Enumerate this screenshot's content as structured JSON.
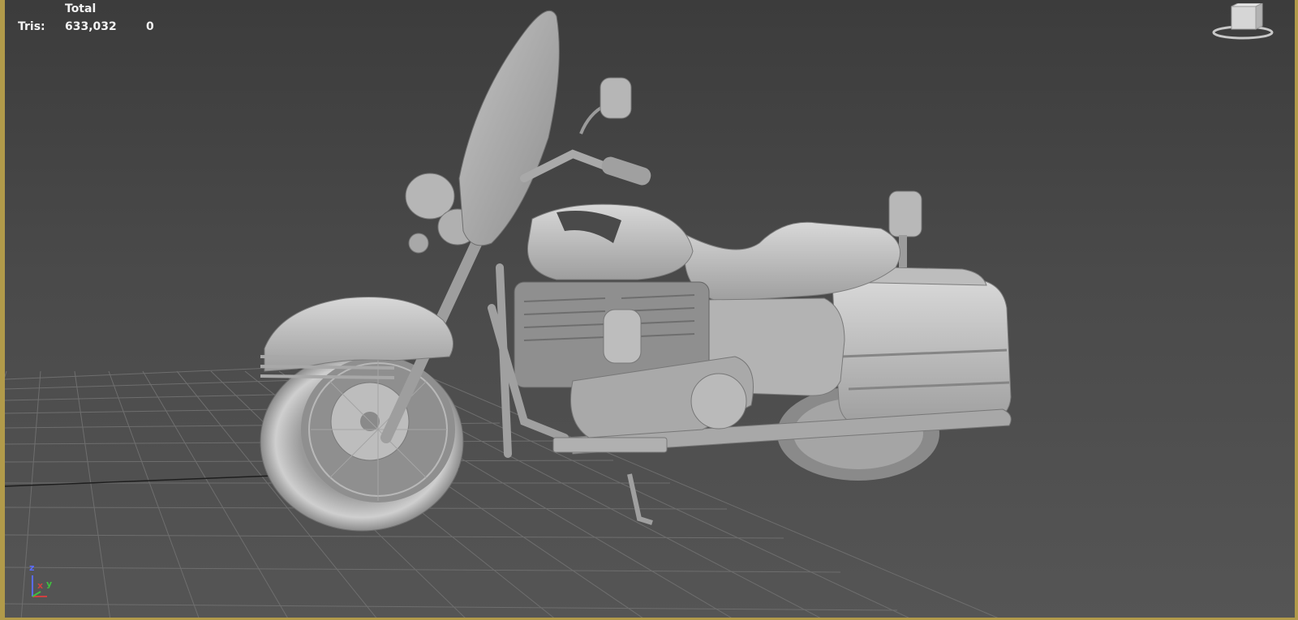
{
  "stats": {
    "header": "Total",
    "rows": [
      {
        "label": "Tris:",
        "total": "633,032",
        "selected": "0"
      }
    ]
  },
  "axis": {
    "z": "z",
    "x": "x",
    "y": "y",
    "colors": {
      "x": "#d04040",
      "y": "#40c040",
      "z": "#5a6cff"
    }
  },
  "viewcube": {
    "icon": "viewcube-icon"
  },
  "colors": {
    "viewport_border": "#b19a4a",
    "grid_line": "#6e6e6e",
    "grid_axis": "#1e1e1e",
    "model": "#c9c9c9"
  }
}
